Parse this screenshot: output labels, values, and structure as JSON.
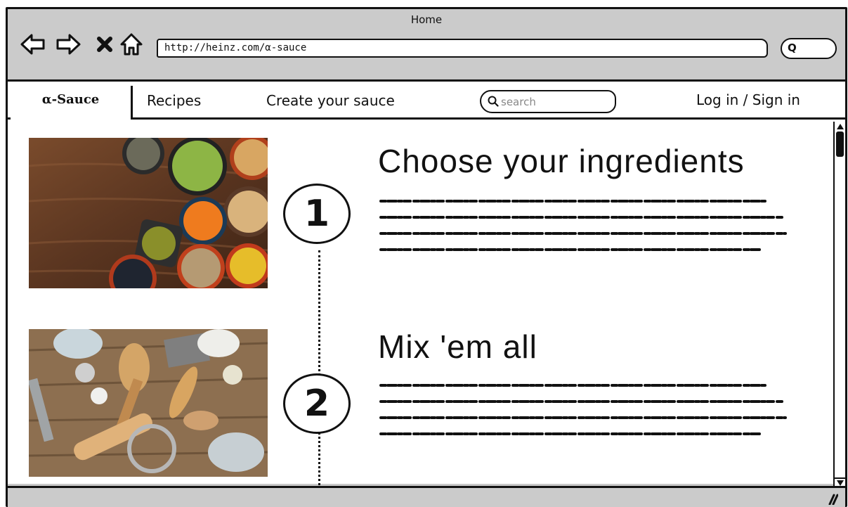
{
  "window": {
    "title": "Home"
  },
  "browser": {
    "url": "http://heinz.com/α-sauce",
    "search_glyph": "Q"
  },
  "nav": {
    "brand": "α-Sauce",
    "links": [
      "Recipes",
      "Create your sauce"
    ],
    "search_placeholder": "search",
    "login": "Log in / Sign in"
  },
  "steps": [
    {
      "number": "1",
      "heading": "Choose your ingredients"
    },
    {
      "number": "2",
      "heading": "Mix 'em all"
    }
  ],
  "icons": {
    "back": "arrow-left-icon",
    "forward": "arrow-right-icon",
    "stop": "close-icon",
    "home": "home-icon",
    "search": "search-icon",
    "resize": "resize-grip-icon"
  },
  "colors": {
    "chrome": "#cbcbcb",
    "ink": "#111111",
    "page": "#ffffff"
  }
}
